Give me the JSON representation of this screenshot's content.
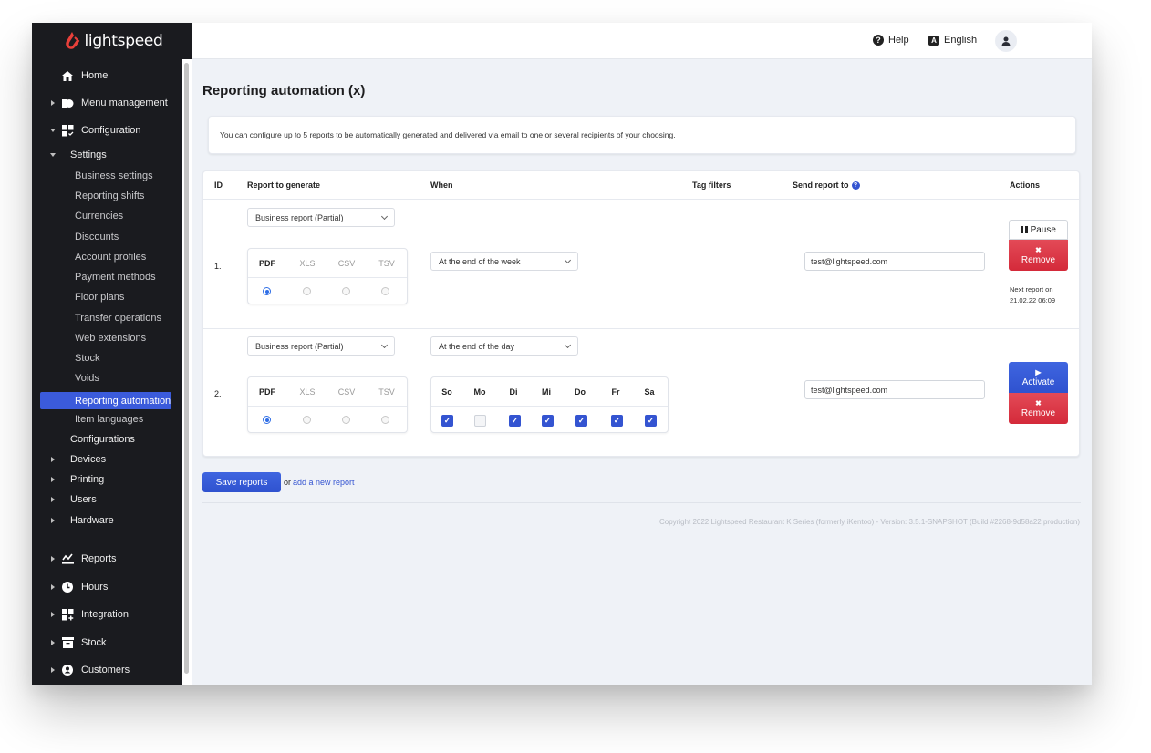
{
  "app": {
    "brand": "lightspeed",
    "brand_color": "#e8403a",
    "accent_color": "#3454d1",
    "danger_color": "#d9303f"
  },
  "topbar": {
    "help_label": "Help",
    "language_label": "English",
    "help_icon": "question-circle-icon",
    "language_icon": "language-icon",
    "avatar_icon": "user-icon"
  },
  "sidebar": {
    "items": [
      {
        "label": "Home",
        "icon": "home-icon",
        "level": 1,
        "caret": "none"
      },
      {
        "label": "Menu management",
        "icon": "menu-management-icon",
        "level": 1,
        "caret": "right"
      },
      {
        "label": "Configuration",
        "icon": "configuration-icon",
        "level": 1,
        "caret": "down"
      },
      {
        "label": "Settings",
        "level": 2,
        "caret": "down"
      },
      {
        "label": "Business settings",
        "level": 3
      },
      {
        "label": "Reporting shifts",
        "level": 3
      },
      {
        "label": "Currencies",
        "level": 3
      },
      {
        "label": "Discounts",
        "level": 3
      },
      {
        "label": "Account profiles",
        "level": 3
      },
      {
        "label": "Payment methods",
        "level": 3
      },
      {
        "label": "Floor plans",
        "level": 3
      },
      {
        "label": "Transfer operations",
        "level": 3
      },
      {
        "label": "Web extensions",
        "level": 3
      },
      {
        "label": "Stock",
        "level": 3
      },
      {
        "label": "Voids",
        "level": 3
      },
      {
        "label": "Reporting automation",
        "level": 3,
        "active": true
      },
      {
        "label": "Item languages",
        "level": 3
      },
      {
        "label": "Configurations",
        "level": 2,
        "caret": "none"
      },
      {
        "label": "Devices",
        "level": 2,
        "caret": "right"
      },
      {
        "label": "Printing",
        "level": 2,
        "caret": "right"
      },
      {
        "label": "Users",
        "level": 2,
        "caret": "right"
      },
      {
        "label": "Hardware",
        "level": 2,
        "caret": "right"
      },
      {
        "label": "Reports",
        "icon": "reports-icon",
        "level": 1,
        "caret": "right"
      },
      {
        "label": "Hours",
        "icon": "clock-icon",
        "level": 1,
        "caret": "right"
      },
      {
        "label": "Integration",
        "icon": "integration-icon",
        "level": 1,
        "caret": "right"
      },
      {
        "label": "Stock",
        "icon": "stock-icon",
        "level": 1,
        "caret": "right"
      },
      {
        "label": "Customers",
        "icon": "customers-icon",
        "level": 1,
        "caret": "right"
      }
    ]
  },
  "page": {
    "title": "Reporting automation (x)",
    "info": "You can configure up to 5 reports to be automatically generated and delivered via email to one or several recipients of your choosing."
  },
  "table": {
    "headers": {
      "id": "ID",
      "report": "Report to generate",
      "when": "When",
      "tags": "Tag filters",
      "send": "Send report to",
      "actions": "Actions"
    },
    "formats": [
      "PDF",
      "XLS",
      "CSV",
      "TSV"
    ],
    "days": [
      "So",
      "Mo",
      "Di",
      "Mi",
      "Do",
      "Fr",
      "Sa"
    ],
    "rows": [
      {
        "id": "1.",
        "report": "Business report (Partial)",
        "format_selected": "PDF",
        "when": "At the end of the week",
        "email": "test@lightspeed.com",
        "primary_action": "Pause",
        "remove_label": "Remove",
        "next_report_label": "Next report on",
        "next_report_date": "21.02.22 06:09"
      },
      {
        "id": "2.",
        "report": "Business report (Partial)",
        "format_selected": "PDF",
        "when": "At the end of the day",
        "days_checked": [
          true,
          false,
          true,
          true,
          true,
          true,
          true
        ],
        "email": "test@lightspeed.com",
        "primary_action": "Activate",
        "remove_label": "Remove"
      }
    ]
  },
  "footer": {
    "save_label": "Save reports",
    "or_text": "or",
    "add_link": "add a new report",
    "copyright": "Copyright 2022 Lightspeed Restaurant K Series (formerly iKentoo) - Version: 3.5.1-SNAPSHOT (Build #2268-9d58a22 production)"
  }
}
